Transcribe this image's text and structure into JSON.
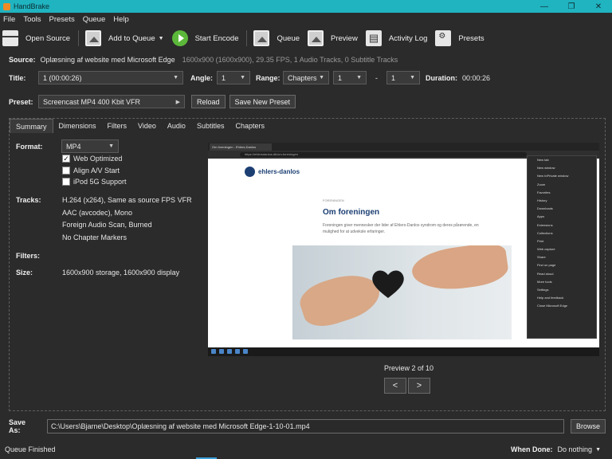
{
  "window": {
    "title": "HandBrake",
    "controls": [
      "—",
      "❐",
      "✕"
    ]
  },
  "menu": [
    "File",
    "Tools",
    "Presets",
    "Queue",
    "Help"
  ],
  "toolbar": {
    "open_source": "Open Source",
    "add_to_queue": "Add to Queue",
    "start_encode": "Start Encode",
    "queue": "Queue",
    "preview": "Preview",
    "activity_log": "Activity Log",
    "presets": "Presets"
  },
  "source": {
    "label": "Source:",
    "name": "Oplæsning af website med Microsoft Edge",
    "info": "1600x900 (1600x900), 29.35 FPS, 1 Audio Tracks, 0 Subtitle Tracks"
  },
  "title_row": {
    "title_label": "Title:",
    "title_value": "1  (00:00:26)",
    "angle_label": "Angle:",
    "angle_value": "1",
    "range_label": "Range:",
    "range_type": "Chapters",
    "range_start": "1",
    "range_dash": "-",
    "range_end": "1",
    "duration_label": "Duration:",
    "duration_value": "00:00:26"
  },
  "preset_row": {
    "label": "Preset:",
    "value": "Screencast MP4 400 Kbit VFR",
    "reload": "Reload",
    "save_new": "Save New Preset"
  },
  "tabs": [
    "Summary",
    "Dimensions",
    "Filters",
    "Video",
    "Audio",
    "Subtitles",
    "Chapters"
  ],
  "summary": {
    "format_label": "Format:",
    "format_value": "MP4",
    "web_optimized": "Web Optimized",
    "web_optimized_checked": true,
    "align_av": "Align A/V Start",
    "align_av_checked": false,
    "ipod": "iPod 5G Support",
    "ipod_checked": false,
    "tracks_label": "Tracks:",
    "tracks": [
      "H.264 (x264), Same as source FPS VFR",
      "AAC (avcodec), Mono",
      "Foreign Audio Scan, Burned",
      "No Chapter Markers"
    ],
    "filters_label": "Filters:",
    "size_label": "Size:",
    "size_value": "1600x900 storage, 1600x900 display"
  },
  "preview": {
    "caption": "Preview 2 of 10",
    "prev": "<",
    "next": ">",
    "tab_title": "Om foreningen - Ehlers-Danlos",
    "url": "https://ehlersdanlos.dk/om-foreningen",
    "logo": "ehlers-danlos",
    "kicker": "FORENINGEN",
    "heading": "Om foreningen",
    "body": "Foreningen giver mennesker der lider af Ehlers-Danlos syndrom og deres pårørende, en mulighed for at udveksle erfaringer.",
    "menu_items": [
      "New tab",
      "New window",
      "New InPrivate window",
      "Zoom",
      "Favorites",
      "History",
      "Downloads",
      "Apps",
      "Extensions",
      "Collections",
      "Print",
      "Web capture",
      "Share",
      "Find on page",
      "Read aloud",
      "More tools",
      "Settings",
      "Help and feedback",
      "Close Microsoft Edge"
    ]
  },
  "save_as": {
    "label": "Save As:",
    "path": "C:\\Users\\Bjarne\\Desktop\\Oplæsning af website med Microsoft Edge-1-10-01.mp4",
    "browse": "Browse"
  },
  "status": {
    "text": "Queue Finished",
    "when_done_label": "When Done:",
    "when_done_value": "Do nothing"
  }
}
